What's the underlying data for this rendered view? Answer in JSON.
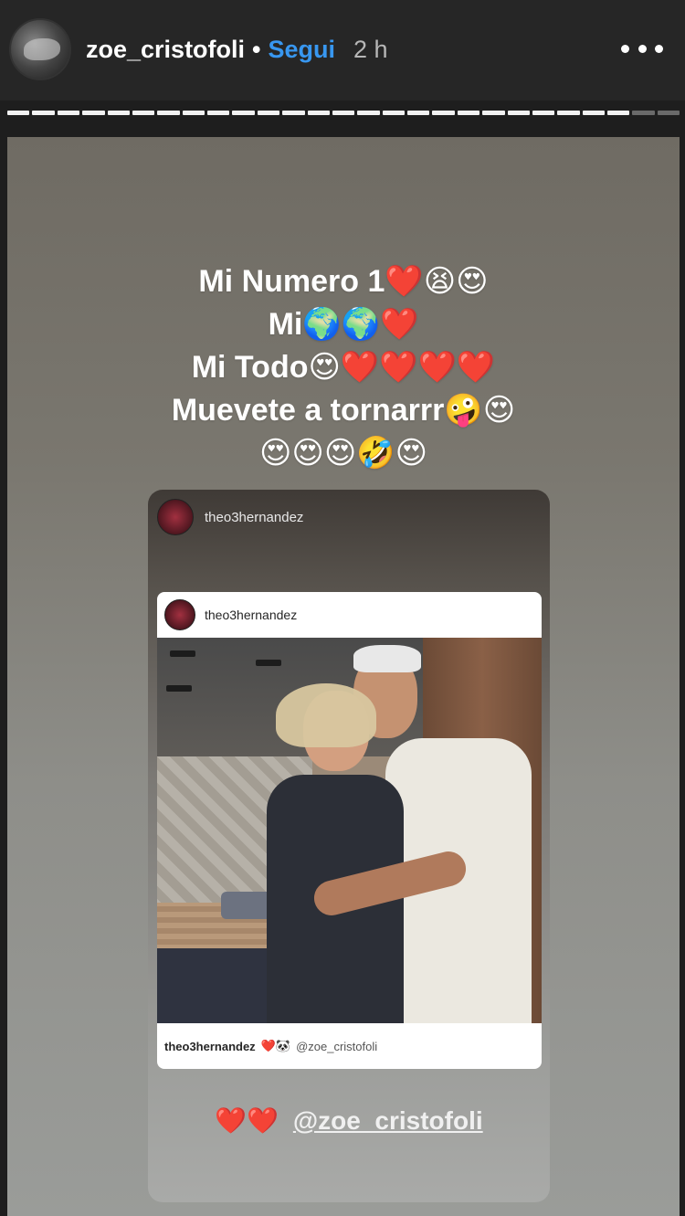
{
  "header": {
    "username": "zoe_cristofoli",
    "separator": "•",
    "follow_label": "Segui",
    "time": "2 h",
    "more_icon": "more-horizontal-icon"
  },
  "progress": {
    "segments": 27,
    "completed": 25
  },
  "story": {
    "caption_lines": [
      "Mi Numero 1❤️😫😍",
      "Mi🌍🌍❤️",
      "Mi Todo😍❤️❤️❤️❤️",
      "Muevete a tornarrr🤪😍",
      "😍😍😍🤣😍"
    ],
    "shared_card": {
      "author": "theo3hernandez",
      "post": {
        "author": "theo3hernandez",
        "caption_user": "theo3hernandez",
        "caption_emojis": "❤️🐼",
        "caption_tag": "@zoe_cristofoli"
      },
      "bottom_hearts": "❤️❤️",
      "bottom_mention": "@zoe_cristofoli"
    }
  }
}
